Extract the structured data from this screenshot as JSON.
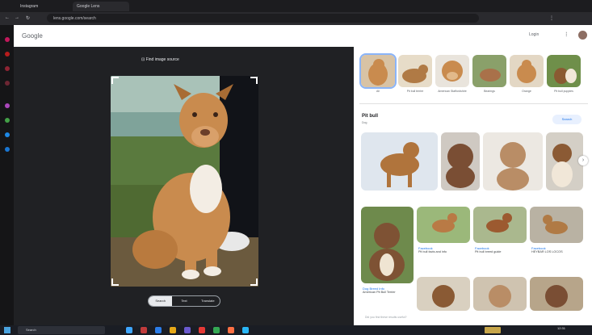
{
  "browser": {
    "tabs": [
      "Instagram",
      "Google Lens"
    ],
    "url": "lens.google.com/search"
  },
  "header": {
    "logo": "Google",
    "signin": "Login"
  },
  "lens": {
    "find_source": "Find image source",
    "mode_buttons": [
      "Search",
      "Text",
      "Translate"
    ],
    "active_mode": 0
  },
  "results": {
    "thumbnails": [
      "All",
      "Pit bull terrier",
      "American Staffordshire",
      "Bearings",
      "Orange",
      "Pit bull puppies"
    ],
    "section_title": "Pit bull",
    "section_sub": "Dog",
    "search_button": "Search",
    "cards": [
      {
        "source": "Facebook",
        "caption": "Pit bull facts and info"
      },
      {
        "source": "Facebook",
        "caption": "Pit bull breed guide"
      },
      {
        "source": "Facebook",
        "caption": "HEYBAR LOS LOCOS"
      },
      {
        "source": "Dog Breed Info",
        "caption": "American Pit Bull Terrier"
      }
    ],
    "feedback": "Did you find these results useful?"
  },
  "taskbar": {
    "search": "Search",
    "time": "12:31",
    "date": "5/14/2024"
  },
  "colors": {
    "accent": "#1a73e8",
    "panel_dark": "#202124"
  }
}
